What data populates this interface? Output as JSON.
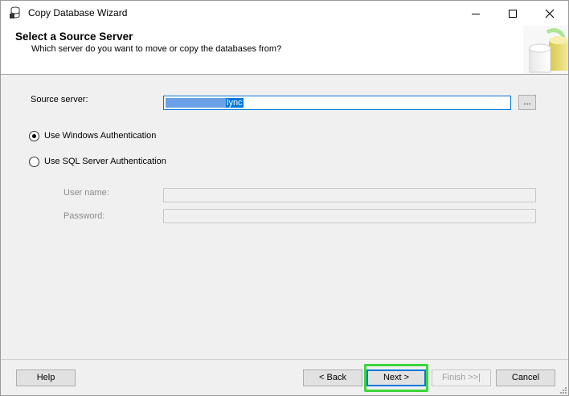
{
  "window": {
    "title": "Copy Database Wizard"
  },
  "header": {
    "title": "Select a Source Server",
    "subtitle": "Which server do you want to move or copy the databases from?"
  },
  "form": {
    "source_server_label": "Source server:",
    "source_server_value_visible": "lync",
    "browse_label": "...",
    "auth_windows_label": "Use Windows Authentication",
    "auth_sql_label": "Use SQL Server Authentication",
    "auth_selected": "windows",
    "username_label": "User name:",
    "username_value": "",
    "password_label": "Password:",
    "password_value": ""
  },
  "buttons": {
    "help": "Help",
    "back": "< Back",
    "next": "Next >",
    "finish": "Finish >>|",
    "cancel": "Cancel"
  },
  "colors": {
    "highlight": "#3ad63a",
    "accent": "#0078d7"
  }
}
